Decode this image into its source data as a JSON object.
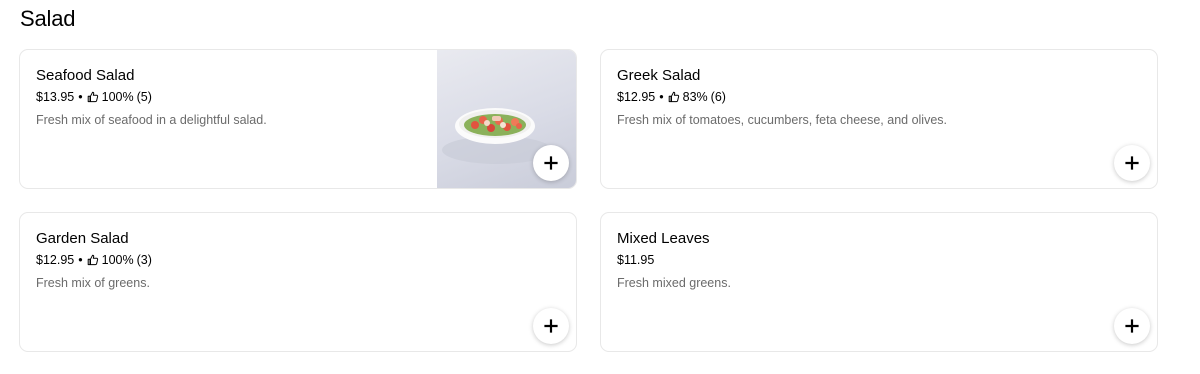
{
  "section": {
    "title": "Salad"
  },
  "items": [
    {
      "name": "Seafood Salad",
      "price": "$13.95",
      "separator": "•",
      "rating_percent": "100%",
      "rating_count": "(5)",
      "description": "Fresh mix of seafood in a delightful salad.",
      "has_photo": true,
      "rating_icon": "thumbs-up-icon",
      "add_icon": "plus-icon"
    },
    {
      "name": "Greek Salad",
      "price": "$12.95",
      "separator": "•",
      "rating_percent": "83%",
      "rating_count": "(6)",
      "description": "Fresh mix of tomatoes, cucumbers, feta cheese, and olives.",
      "has_photo": false,
      "rating_icon": "thumbs-up-icon",
      "add_icon": "plus-icon"
    },
    {
      "name": "Garden Salad",
      "price": "$12.95",
      "separator": "•",
      "rating_percent": "100%",
      "rating_count": "(3)",
      "description": "Fresh mix of greens.",
      "has_photo": false,
      "rating_icon": "thumbs-up-icon",
      "add_icon": "plus-icon"
    },
    {
      "name": "Mixed Leaves",
      "price": "$11.95",
      "description": "Fresh mixed greens.",
      "has_photo": false,
      "add_icon": "plus-icon"
    }
  ],
  "colors": {
    "border": "#e8e8e8",
    "description_text": "#6b6b6b",
    "text": "#000000"
  }
}
